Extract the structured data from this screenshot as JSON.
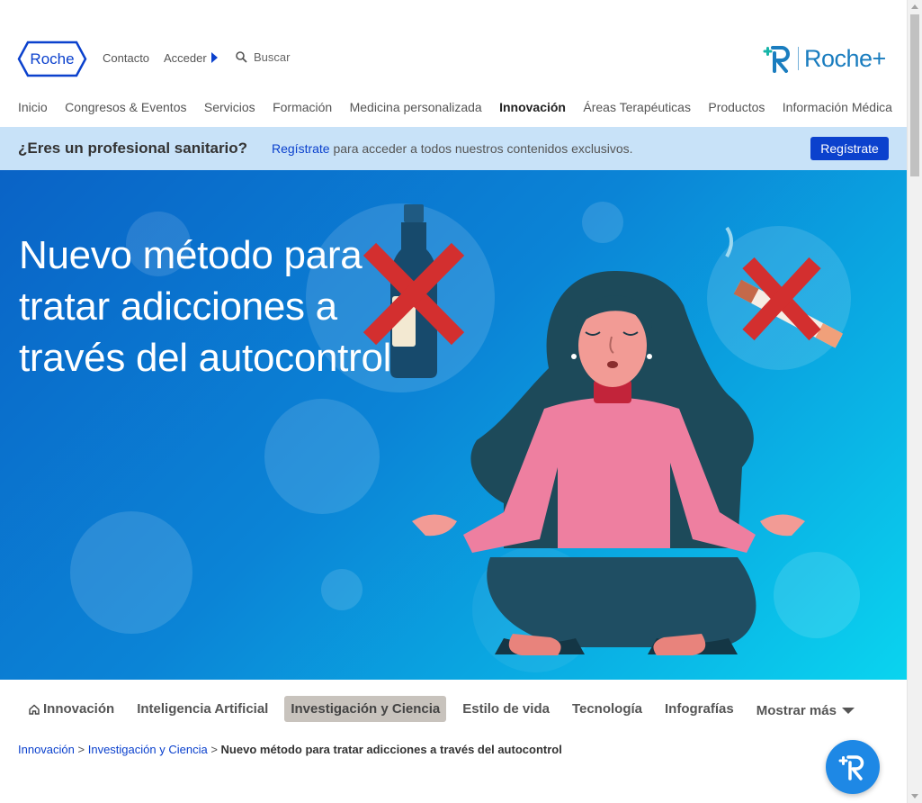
{
  "header": {
    "logo_text": "Roche",
    "contact_label": "Contacto",
    "login_label": "Acceder",
    "search_placeholder": "Buscar",
    "brand_plus_text": "Roche+"
  },
  "nav": {
    "items": [
      {
        "label": "Inicio"
      },
      {
        "label": "Congresos & Eventos"
      },
      {
        "label": "Servicios"
      },
      {
        "label": "Formación"
      },
      {
        "label": "Medicina personalizada"
      },
      {
        "label": "Innovación",
        "active": true
      },
      {
        "label": "Áreas Terapéuticas"
      },
      {
        "label": "Productos"
      },
      {
        "label": "Información Médica"
      }
    ]
  },
  "banner": {
    "question": "¿Eres un profesional sanitario?",
    "link_text": "Regístrate",
    "message": " para acceder a todos nuestros contenidos exclusivos.",
    "button_label": "Regístrate"
  },
  "hero": {
    "title": "Nuevo método para tratar adicciones a través del autocontrol"
  },
  "subnav": {
    "items": [
      {
        "label": "Innovación",
        "icon": "home-icon"
      },
      {
        "label": "Inteligencia Artificial"
      },
      {
        "label": "Investigación y Ciencia",
        "active": true
      },
      {
        "label": "Estilo de vida"
      },
      {
        "label": "Tecnología"
      },
      {
        "label": "Infografías"
      }
    ],
    "more_label": "Mostrar más"
  },
  "breadcrumb": {
    "items": [
      "Innovación",
      "Investigación y Ciencia"
    ],
    "separator": ">",
    "current": "Nuevo método para tratar adicciones a través del autocontrol"
  },
  "colors": {
    "brand_blue": "#0b41cd",
    "banner_bg": "#c8e2f8",
    "hero_start": "#0a63c6",
    "hero_end": "#0ad4ef",
    "cross_red": "#d32f2f",
    "sweater_pink": "#ee7fa0",
    "hair_teal": "#1d4a5a"
  }
}
